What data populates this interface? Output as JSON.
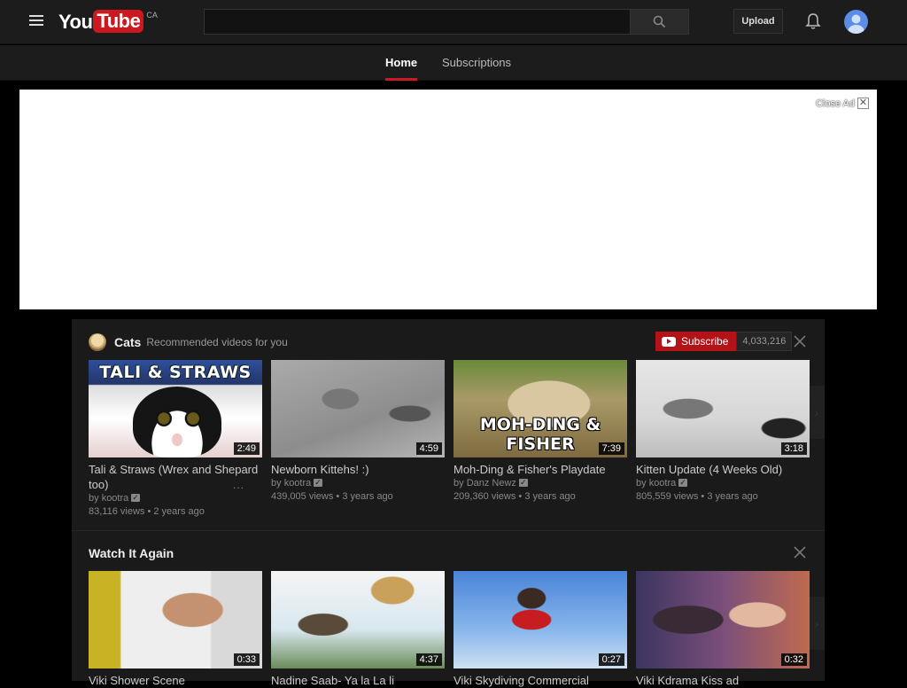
{
  "masthead": {
    "logo_you": "You",
    "logo_tube": "Tube",
    "region": "CA",
    "search_placeholder": "",
    "upload_label": "Upload"
  },
  "tabs": [
    {
      "label": "Home",
      "active": true
    },
    {
      "label": "Subscriptions",
      "active": false
    }
  ],
  "ad": {
    "close_label": "Close Ad",
    "close_icon": "✕"
  },
  "shelves": [
    {
      "title": "Cats",
      "subtitle": "Recommended videos for you",
      "subscribe_label": "Subscribe",
      "subscriber_count": "4,033,216",
      "videos": [
        {
          "title": "Tali & Straws (Wrex and Shepard too)",
          "channel": "kootra",
          "verified": true,
          "views": "83,116 views",
          "age": "2 years ago",
          "duration": "2:49",
          "thumb_text": "TALI & STRAWS"
        },
        {
          "title": "Newborn Kittehs! :)",
          "channel": "kootra",
          "verified": true,
          "views": "439,005 views",
          "age": "3 years ago",
          "duration": "4:59"
        },
        {
          "title": "Moh-Ding & Fisher's Playdate",
          "channel": "Danz Newz",
          "verified": true,
          "views": "209,360 views",
          "age": "3 years ago",
          "duration": "7:39",
          "thumb_text": "MOH-DING & FISHER"
        },
        {
          "title": "Kitten Update (4 Weeks Old)",
          "channel": "kootra",
          "verified": true,
          "views": "805,559 views",
          "age": "3 years ago",
          "duration": "3:18"
        }
      ]
    },
    {
      "title": "Watch It Again",
      "videos": [
        {
          "title": "Viki Shower Scene",
          "duration": "0:33"
        },
        {
          "title": "Nadine Saab- Ya la La li",
          "duration": "4:37"
        },
        {
          "title": "Viki Skydiving Commercial",
          "duration": "0:27"
        },
        {
          "title": "Viki Kdrama Kiss ad",
          "duration": "0:32"
        }
      ]
    }
  ],
  "meta": {
    "by": "by",
    "dot": "•",
    "more": "..."
  },
  "colors": {
    "brand_red": "#cc181e",
    "subscribe_red": "#b31217",
    "background": "#000000",
    "masthead": "#1c1c1c",
    "feed": "#1a1a1a"
  },
  "icons": [
    "menu-icon",
    "search-icon",
    "bell-icon",
    "avatar-icon",
    "close-icon",
    "verified-icon",
    "play-icon",
    "chevron-right-icon"
  ]
}
